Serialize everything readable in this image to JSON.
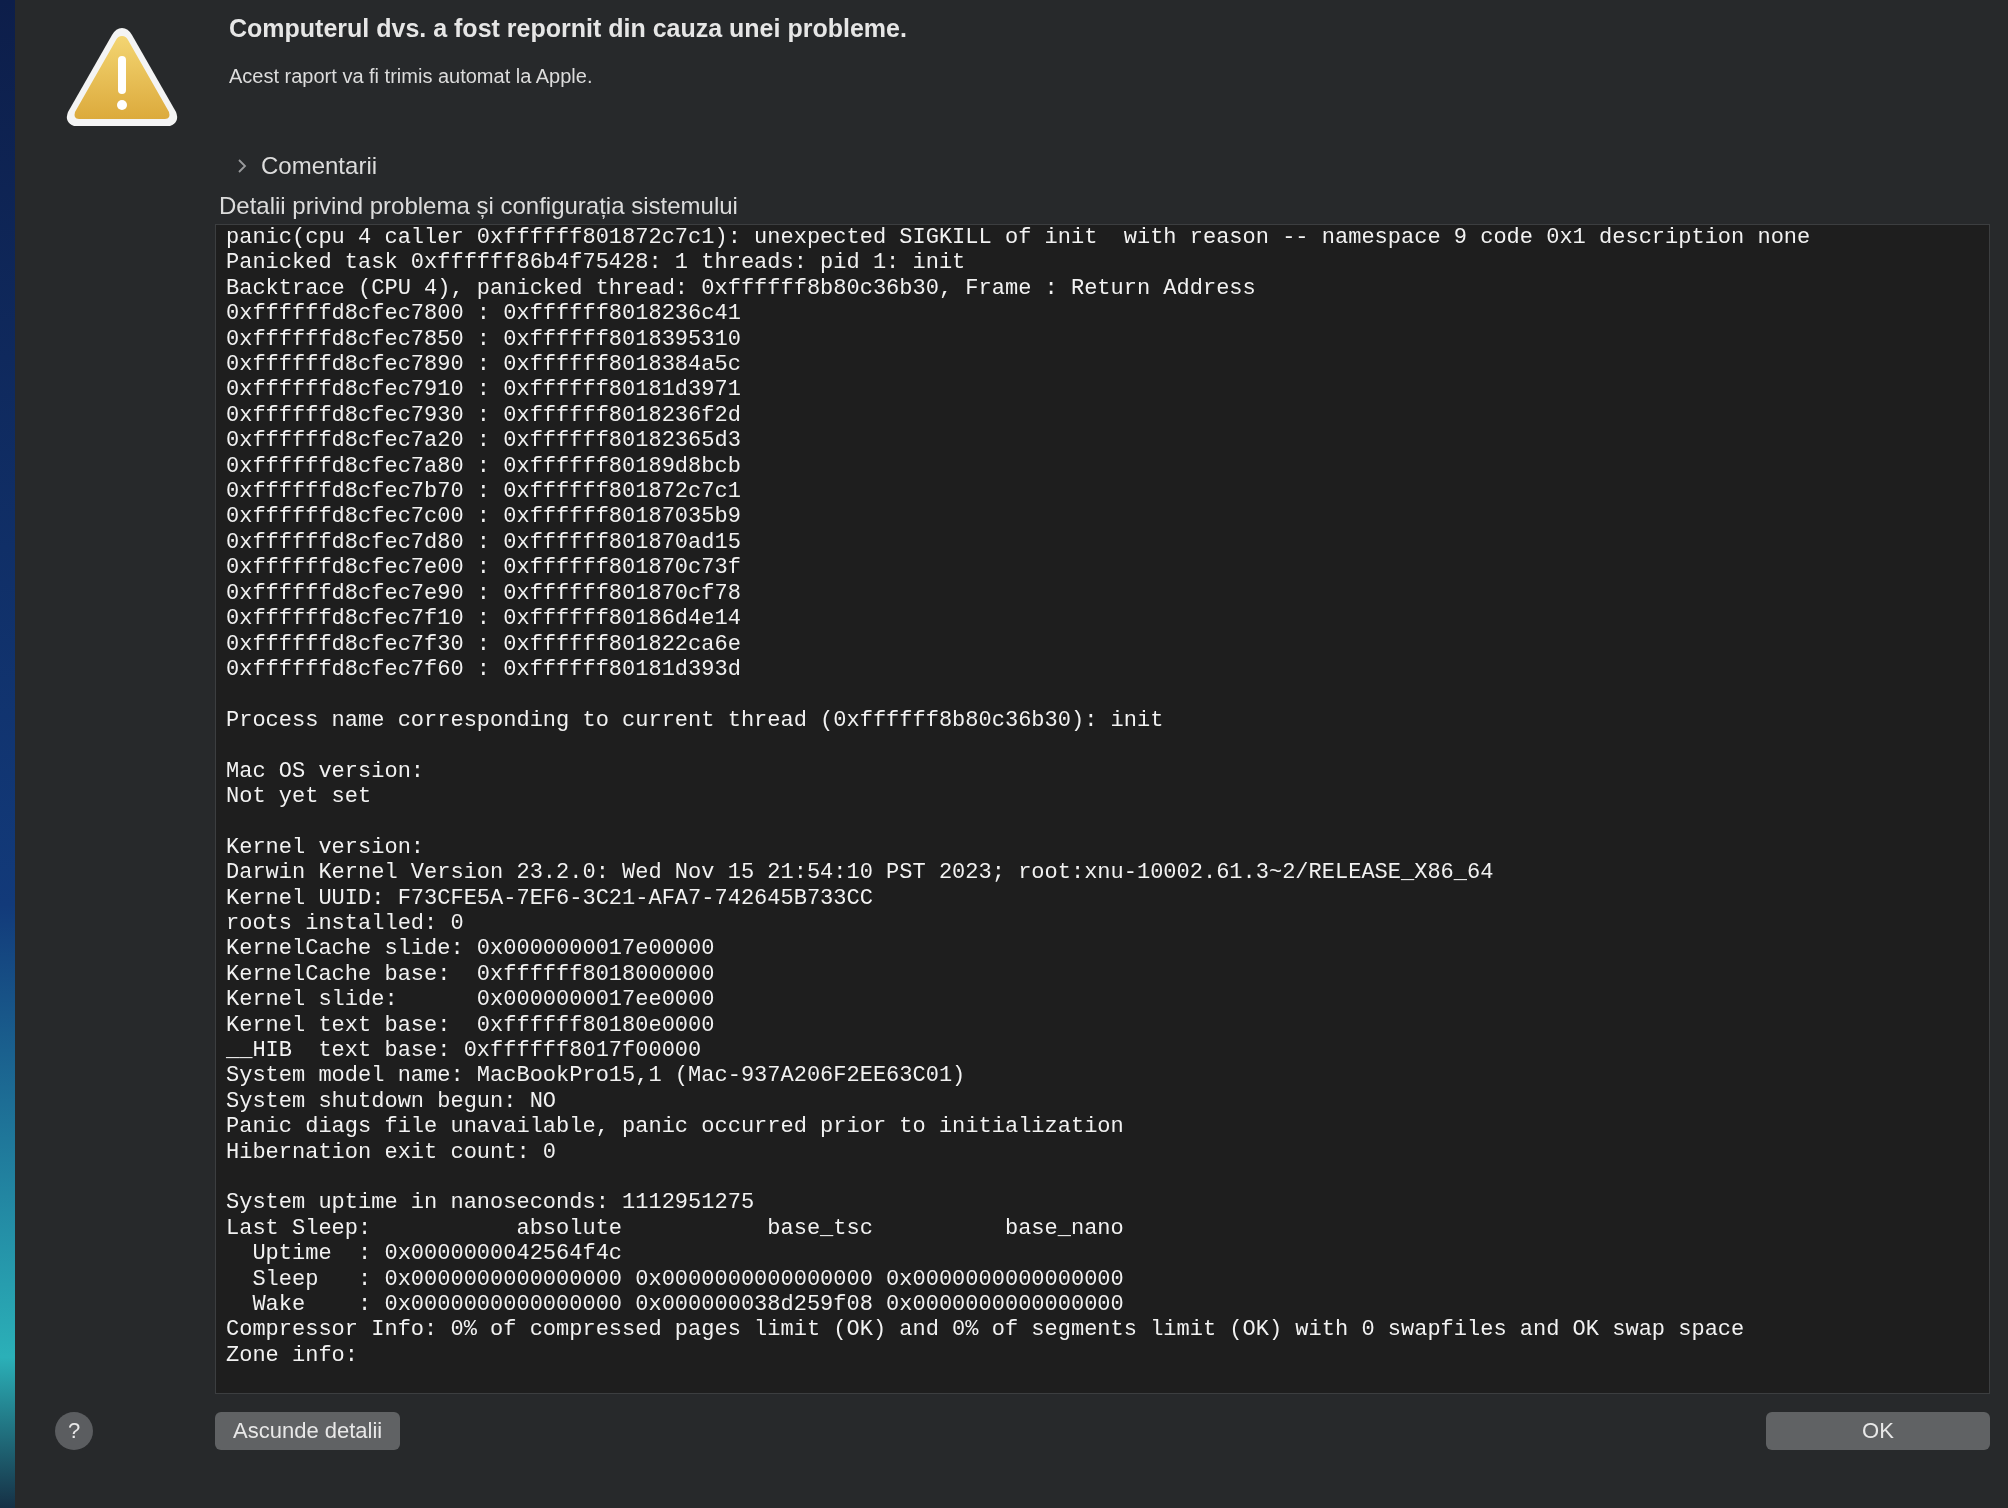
{
  "dialog": {
    "title": "Computerul dvs. a fost repornit din cauza unei probleme.",
    "subtitle": "Acest raport va fi trimis automat la Apple."
  },
  "comments": {
    "label": "Comentarii",
    "expanded": false
  },
  "details": {
    "label": "Detalii privind problema și configurația sistemului",
    "blocks": [
      [
        "panic(cpu 4 caller 0xffffff801872c7c1): unexpected SIGKILL of init  with reason -- namespace 9 code 0x1 description none",
        "Panicked task 0xffffff86b4f75428: 1 threads: pid 1: init",
        "Backtrace (CPU 4), panicked thread: 0xffffff8b80c36b30, Frame : Return Address",
        "0xffffffd8cfec7800 : 0xffffff8018236c41",
        "0xffffffd8cfec7850 : 0xffffff8018395310",
        "0xffffffd8cfec7890 : 0xffffff8018384a5c",
        "0xffffffd8cfec7910 : 0xffffff80181d3971",
        "0xffffffd8cfec7930 : 0xffffff8018236f2d",
        "0xffffffd8cfec7a20 : 0xffffff80182365d3",
        "0xffffffd8cfec7a80 : 0xffffff80189d8bcb",
        "0xffffffd8cfec7b70 : 0xffffff801872c7c1",
        "0xffffffd8cfec7c00 : 0xffffff80187035b9",
        "0xffffffd8cfec7d80 : 0xffffff801870ad15",
        "0xffffffd8cfec7e00 : 0xffffff801870c73f",
        "0xffffffd8cfec7e90 : 0xffffff801870cf78",
        "0xffffffd8cfec7f10 : 0xffffff80186d4e14",
        "0xffffffd8cfec7f30 : 0xffffff801822ca6e",
        "0xffffffd8cfec7f60 : 0xffffff80181d393d"
      ],
      [
        "Process name corresponding to current thread (0xffffff8b80c36b30): init"
      ],
      [
        "Mac OS version:",
        "Not yet set"
      ],
      [
        "Kernel version:",
        "Darwin Kernel Version 23.2.0: Wed Nov 15 21:54:10 PST 2023; root:xnu-10002.61.3~2/RELEASE_X86_64",
        "Kernel UUID: F73CFE5A-7EF6-3C21-AFA7-742645B733CC",
        "roots installed: 0",
        "KernelCache slide: 0x0000000017e00000",
        "KernelCache base:  0xffffff8018000000",
        "Kernel slide:      0x0000000017ee0000",
        "Kernel text base:  0xffffff80180e0000",
        "__HIB  text base: 0xffffff8017f00000",
        "System model name: MacBookPro15,1 (Mac-937A206F2EE63C01)",
        "System shutdown begun: NO",
        "Panic diags file unavailable, panic occurred prior to initialization",
        "Hibernation exit count: 0"
      ],
      [
        "System uptime in nanoseconds: 1112951275",
        "Last Sleep:           absolute           base_tsc          base_nano",
        "  Uptime  : 0x0000000042564f4c",
        "  Sleep   : 0x0000000000000000 0x0000000000000000 0x0000000000000000",
        "  Wake    : 0x0000000000000000 0x000000038d259f08 0x0000000000000000",
        "Compressor Info: 0% of compressed pages limit (OK) and 0% of segments limit (OK) with 0 swapfiles and OK swap space",
        "Zone info:"
      ]
    ]
  },
  "buttons": {
    "help": "?",
    "hide_details": "Ascunde detalii",
    "ok": "OK"
  }
}
